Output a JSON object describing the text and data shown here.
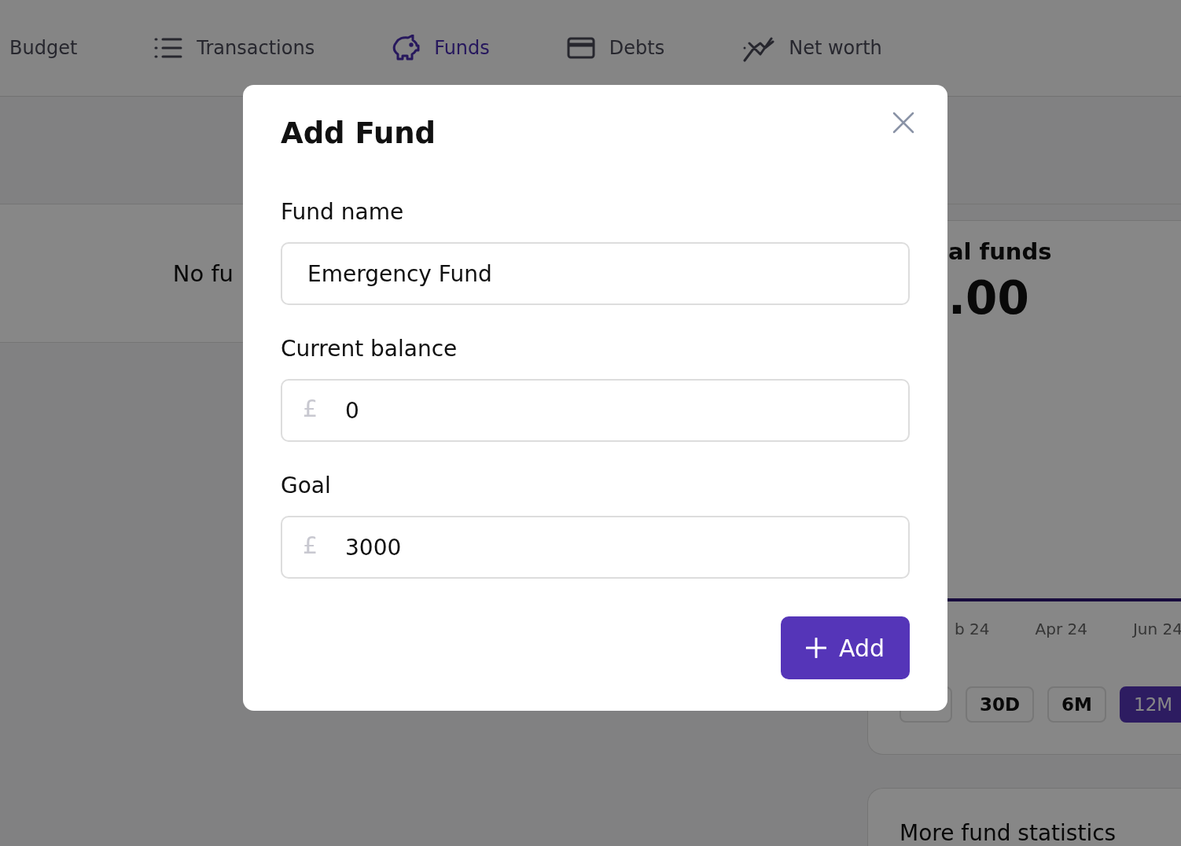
{
  "nav": {
    "items": [
      {
        "label": "Budget",
        "selected": false
      },
      {
        "label": "Transactions",
        "selected": false
      },
      {
        "label": "Funds",
        "selected": true
      },
      {
        "label": "Debts",
        "selected": false
      },
      {
        "label": "Net worth",
        "selected": false
      }
    ]
  },
  "fund_list": {
    "empty_text": "No fu"
  },
  "summary": {
    "title": "al funds",
    "total": ".00",
    "chart_x_labels": [
      "b 24",
      "Apr 24",
      "Jun 24"
    ],
    "periods": [
      {
        "label": "30D",
        "selected": false
      },
      {
        "label": "6M",
        "selected": false
      },
      {
        "label": "12M",
        "selected": true
      }
    ]
  },
  "stats_card": {
    "title": "More fund statistics"
  },
  "modal": {
    "title": "Add Fund",
    "fields": [
      {
        "label": "Fund name",
        "kind": "text",
        "value": "Emergency Fund"
      },
      {
        "label": "Current balance",
        "kind": "currency",
        "prefix": "£",
        "value": "0"
      },
      {
        "label": "Goal",
        "kind": "currency",
        "prefix": "£",
        "value": "3000"
      }
    ],
    "submit": {
      "label": "Add"
    }
  }
}
